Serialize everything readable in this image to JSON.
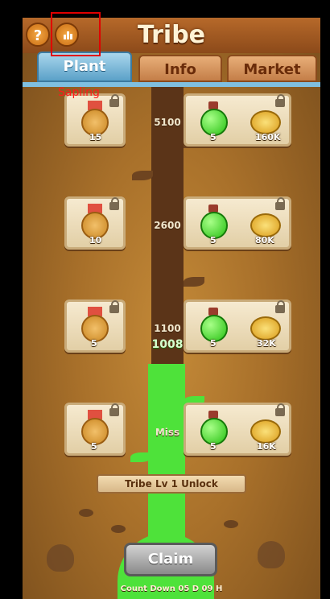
{
  "header": {
    "title": "Tribe",
    "help_label": "?"
  },
  "annotation": {
    "label": "Sapling"
  },
  "tabs": [
    {
      "label": "Plant",
      "active": true
    },
    {
      "label": "Info",
      "active": false
    },
    {
      "label": "Market",
      "active": false
    }
  ],
  "milestones": [
    "5100",
    "2600",
    "1100",
    "1008",
    "Miss"
  ],
  "tiers": [
    {
      "medal_qty": "15",
      "potion_qty": "5",
      "coin_qty": "160K",
      "locked": true
    },
    {
      "medal_qty": "10",
      "potion_qty": "5",
      "coin_qty": "80K",
      "locked": true
    },
    {
      "medal_qty": "5",
      "potion_qty": "5",
      "coin_qty": "32K",
      "locked": true
    },
    {
      "medal_qty": "5",
      "potion_qty": "5",
      "coin_qty": "16K",
      "locked": true
    }
  ],
  "unlock_text": "Tribe Lv 1 Unlock",
  "claim_label": "Claim",
  "countdown": "Count Down 05 D 09 H",
  "colors": {
    "active_tab": "#5ba1c8",
    "progress_green": "#4ee23a",
    "annotation_red": "#e00000"
  }
}
